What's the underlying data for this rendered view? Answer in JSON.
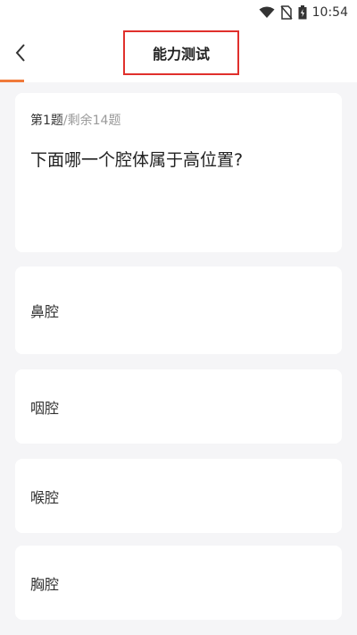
{
  "status_bar": {
    "time": "10:54",
    "icons": [
      "wifi-icon",
      "no-sim-icon",
      "battery-icon"
    ]
  },
  "header": {
    "title": "能力测试",
    "back_icon": "chevron-left-icon"
  },
  "progress": {
    "fraction": 0.0667
  },
  "question": {
    "index_label": "第1题",
    "remaining_label": "/剩余14题",
    "text": "下面哪一个腔体属于高位置?"
  },
  "options": [
    {
      "label": "鼻腔"
    },
    {
      "label": "咽腔"
    },
    {
      "label": "喉腔"
    },
    {
      "label": "胸腔"
    }
  ],
  "colors": {
    "accent": "#f07a3a",
    "highlight_border": "#e0302c",
    "background": "#f5f5f7"
  }
}
